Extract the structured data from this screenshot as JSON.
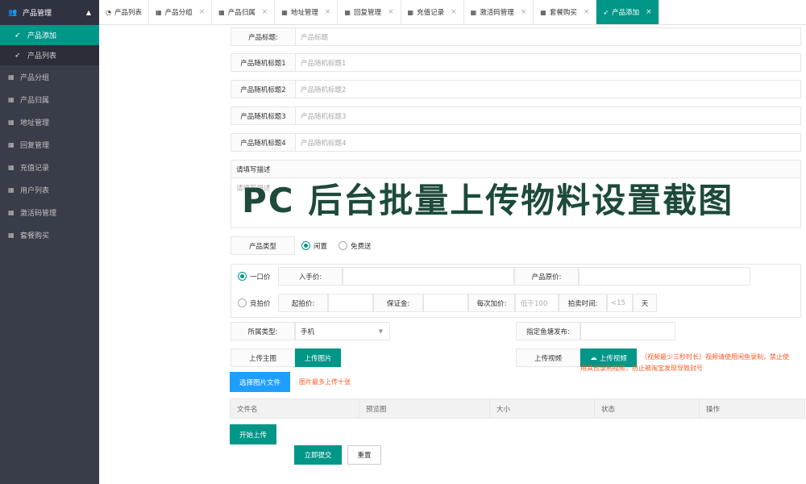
{
  "sidebar": {
    "header": "产品管理",
    "sub": [
      {
        "label": "产品添加",
        "active": true
      },
      {
        "label": "产品列表",
        "active": false
      }
    ],
    "items": [
      "产品分组",
      "产品归属",
      "地址管理",
      "回复管理",
      "充值记录",
      "用户列表",
      "激活码管理",
      "套餐购买"
    ]
  },
  "tabs": [
    {
      "label": "产品列表",
      "icon": "dashboard-icon",
      "closable": false
    },
    {
      "label": "产品分组",
      "closable": true
    },
    {
      "label": "产品归属",
      "closable": true
    },
    {
      "label": "地址管理",
      "closable": true
    },
    {
      "label": "回复管理",
      "closable": true
    },
    {
      "label": "充值记录",
      "closable": true
    },
    {
      "label": "激活码管理",
      "closable": true
    },
    {
      "label": "套餐购买",
      "closable": true
    },
    {
      "label": "产品添加",
      "closable": true,
      "active": true
    }
  ],
  "form": {
    "title": {
      "label": "产品标题:",
      "placeholder": "产品标题"
    },
    "random1": {
      "label": "产品随机标题1",
      "placeholder": "产品随机标题1"
    },
    "random2": {
      "label": "产品随机标题2",
      "placeholder": "产品随机标题2"
    },
    "random3": {
      "label": "产品随机标题3",
      "placeholder": "产品随机标题3"
    },
    "random4": {
      "label": "产品随机标题4",
      "placeholder": "产品随机标题4"
    },
    "description": {
      "label": "请填写描述",
      "placeholder": "请填写描述"
    },
    "product_type": {
      "label": "产品类型",
      "options": [
        "闲置",
        "免费送"
      ],
      "selected": "闲置"
    },
    "fixed_price": {
      "radio": "一口价",
      "selected": true,
      "buy_price_label": "入手价:",
      "original_price_label": "产品原价:"
    },
    "auction": {
      "radio": "竞拍价",
      "start_label": "起拍价:",
      "deposit_label": "保证金:",
      "increment_label": "每次加价:",
      "increment_placeholder": "低于100",
      "duration_label": "拍卖时间:",
      "duration_placeholder": "<15",
      "duration_unit": "天"
    },
    "category": {
      "label": "所属类型:",
      "value": "手机"
    },
    "designated_label": "指定鱼塘发布:",
    "upload_main_label": "上传主图",
    "upload_image_button": "上传图片",
    "upload_video_label": "上传视频",
    "upload_video_button": "上传视频",
    "video_note_1": "（视频最少三秒时长）视频请使用闲鱼录制，禁止使",
    "video_note_2": "用其他录制视频，防止被淘宝发现导致封号",
    "select_file_button": "选择图片文件",
    "image_limit_note": "图片最多上传十张",
    "table_headers": [
      "文件名",
      "预览图",
      "大小",
      "状态",
      "操作"
    ],
    "start_upload_button": "开始上传",
    "submit_button": "立即提交",
    "reset_button": "重置"
  },
  "watermark": "PC 后台批量上传物料设置截图",
  "colors": {
    "accent": "#009688",
    "blue": "#1E9FFF",
    "sidebar": "#393D49",
    "warning": "#FF5722"
  }
}
